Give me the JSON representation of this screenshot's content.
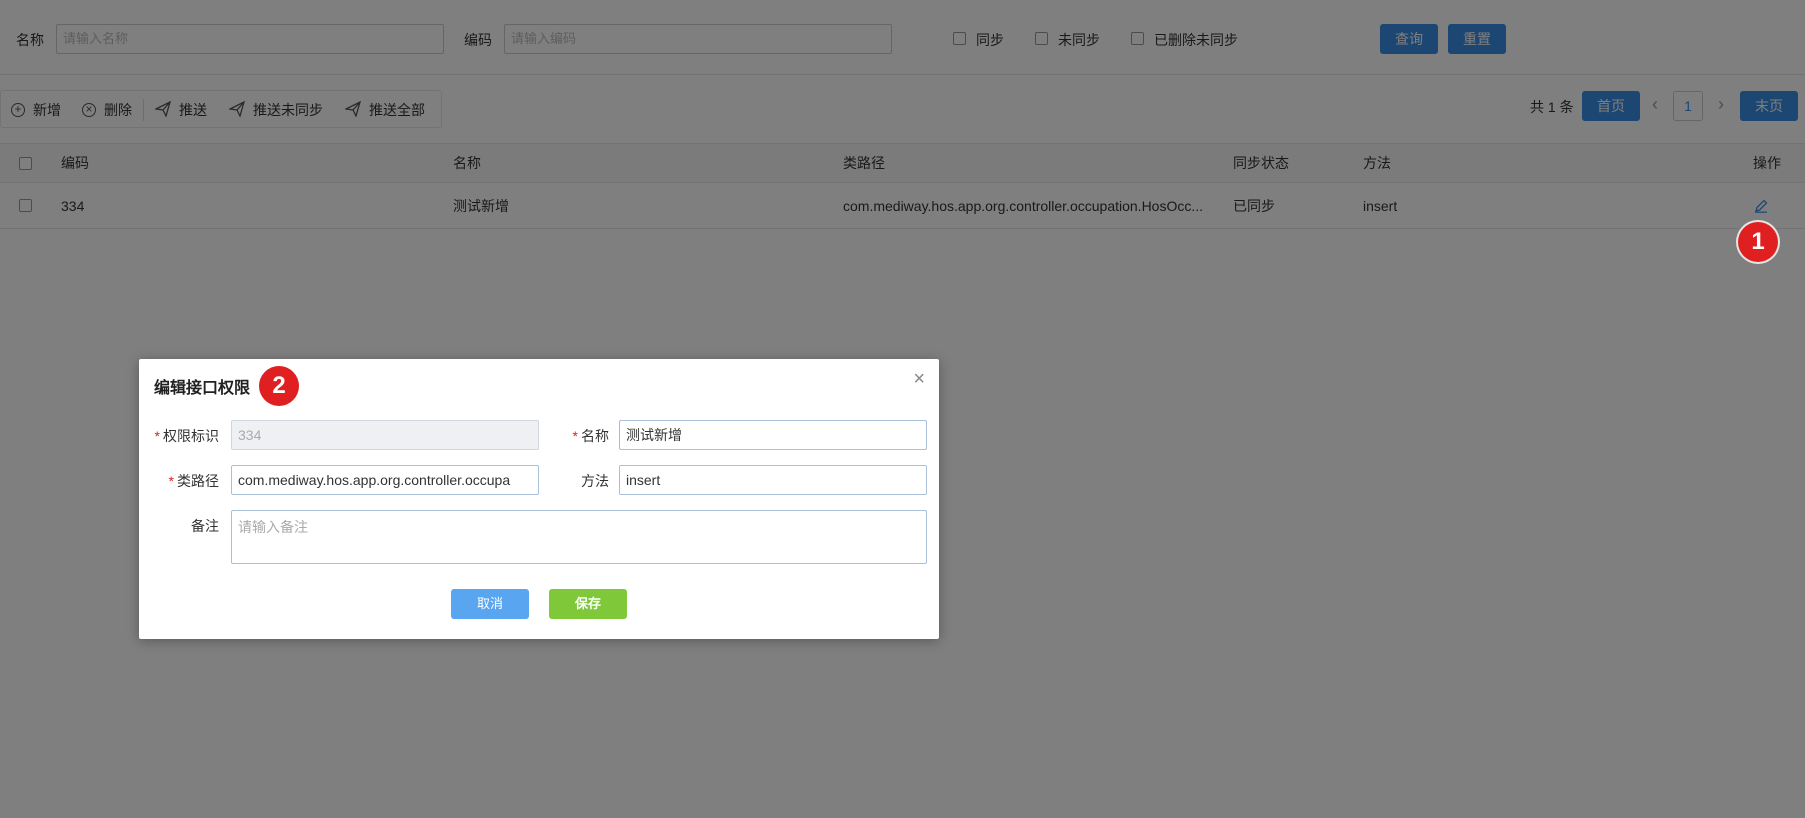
{
  "search": {
    "name_label": "名称",
    "name_placeholder": "请输入名称",
    "code_label": "编码",
    "code_placeholder": "请输入编码",
    "filters": [
      "同步",
      "未同步",
      "已删除未同步"
    ],
    "query_label": "查询",
    "reset_label": "重置"
  },
  "toolbar": {
    "add_label": "新增",
    "delete_label": "删除",
    "push_label": "推送",
    "push_unsynced_label": "推送未同步",
    "push_all_label": "推送全部"
  },
  "pager": {
    "total": "共 1 条",
    "first": "首页",
    "prev": "‹",
    "current": "1",
    "next": "›",
    "last": "末页"
  },
  "table": {
    "headers": [
      "编码",
      "名称",
      "类路径",
      "同步状态",
      "方法",
      "操作"
    ],
    "rows": [
      {
        "code": "334",
        "name": "测试新增",
        "class_path": "com.mediway.hos.app.org.controller.occupation.HosOcc...",
        "sync_status": "已同步",
        "method": "insert"
      }
    ]
  },
  "markers": {
    "m1": "1",
    "m2": "2"
  },
  "modal": {
    "title": "编辑接口权限",
    "close": "×",
    "perm_id_label": "权限标识",
    "perm_id_value": "334",
    "name_label": "名称",
    "name_value": "测试新增",
    "class_path_label": "类路径",
    "class_path_value": "com.mediway.hos.app.org.controller.occupa",
    "method_label": "方法",
    "method_value": "insert",
    "remark_label": "备注",
    "remark_placeholder": "请输入备注",
    "cancel_label": "取消",
    "save_label": "保存"
  },
  "colors": {
    "primary": "#3a8ee6",
    "save_green": "#7ec83a",
    "marker_red": "#e02020"
  }
}
